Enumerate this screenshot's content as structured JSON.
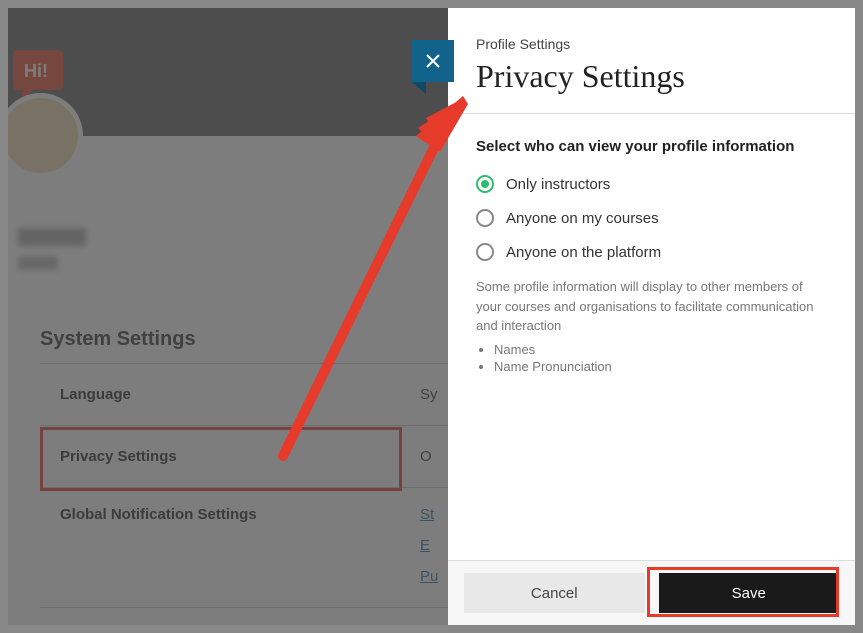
{
  "background": {
    "section_title": "System Settings",
    "rows": {
      "language": {
        "label": "Language",
        "value": "Sy"
      },
      "privacy": {
        "label": "Privacy Settings",
        "value": "O"
      },
      "notifications": {
        "label": "Global Notification Settings",
        "links": [
          "St",
          "E",
          "Pu"
        ]
      }
    },
    "hi_text": "Hi!"
  },
  "panel": {
    "breadcrumb": "Profile Settings",
    "title": "Privacy Settings",
    "prompt": "Select who can view your profile information",
    "options": [
      {
        "label": "Only instructors",
        "selected": true
      },
      {
        "label": "Anyone on my courses",
        "selected": false
      },
      {
        "label": "Anyone on the platform",
        "selected": false
      }
    ],
    "helper": "Some profile information will display to other members of your courses and organisations to facilitate communication and interaction",
    "helper_items": [
      "Names",
      "Name Pronunciation"
    ],
    "footer": {
      "cancel": "Cancel",
      "save": "Save"
    }
  }
}
